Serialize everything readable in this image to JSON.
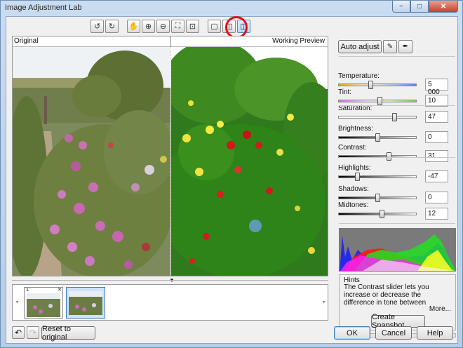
{
  "window": {
    "title": "Image Adjustment Lab",
    "minimize_glyph": "−",
    "maximize_glyph": "□",
    "close_glyph": "✕"
  },
  "toolbar": {
    "buttons": [
      {
        "name": "rotate-left-icon",
        "glyph": "↺"
      },
      {
        "name": "rotate-right-icon",
        "glyph": "↻"
      },
      {
        "name": "pan-hand-icon",
        "glyph": "✋"
      },
      {
        "name": "zoom-in-icon",
        "glyph": "⊕"
      },
      {
        "name": "zoom-out-icon",
        "glyph": "⊖"
      },
      {
        "name": "fit-to-window-icon",
        "glyph": "⛶"
      },
      {
        "name": "actual-size-icon",
        "glyph": "⊡"
      },
      {
        "name": "single-view-icon",
        "glyph": "▢"
      },
      {
        "name": "side-by-side-view-icon",
        "glyph": "◫"
      },
      {
        "name": "split-view-icon",
        "glyph": "◫"
      }
    ],
    "selected": "split-view-icon"
  },
  "preview": {
    "left_label": "Original",
    "right_label": "Working Preview",
    "collapse_glyph": "▼"
  },
  "filmstrip": {
    "left_arrow": "◂",
    "right_arrow": "▸",
    "thumbs": [
      {
        "number": "1",
        "close_glyph": "✕"
      },
      {
        "number": "",
        "close_glyph": ""
      }
    ]
  },
  "controls": {
    "auto_adjust": "Auto adjust",
    "sliders": [
      {
        "label": "Temperature:",
        "value": "5 000",
        "position": 0.41,
        "gradient": "linear-gradient(90deg,#f0a01e,#f6d690,#dcdcdc,#9ac0f0,#4c8ae8)"
      },
      {
        "label": "Tint:",
        "value": "10",
        "position": 0.53,
        "gradient": "linear-gradient(90deg,#d86cf0,#eecdf6,#d8f0c0,#7ed04a)"
      },
      {
        "label": "Saturation:",
        "value": "47",
        "position": 0.71,
        "gradient": "linear-gradient(90deg,#ffffff,#f2f2f2)"
      },
      {
        "label": "Brightness:",
        "value": "0",
        "position": 0.5,
        "gradient": "linear-gradient(90deg,#000000,#ffffff)"
      },
      {
        "label": "Contrast:",
        "value": "31",
        "position": 0.64,
        "gradient": "linear-gradient(90deg,#000000,#ffffff)"
      },
      {
        "label": "Highlights:",
        "value": "-47",
        "position": 0.24,
        "gradient": "linear-gradient(90deg,#000000,#ffffff)"
      },
      {
        "label": "Shadows:",
        "value": "0",
        "position": 0.5,
        "gradient": "linear-gradient(90deg,#000000,#ffffff)"
      },
      {
        "label": "Midtones:",
        "value": "12",
        "position": 0.55,
        "gradient": "linear-gradient(90deg,#000000,#ffffff)"
      }
    ]
  },
  "hints": {
    "title": "Hints",
    "text": "The Contrast slider lets you increase or decrease the difference in tone between",
    "more": "More..."
  },
  "buttons": {
    "create_snapshot": "Create Snapshot",
    "reset": "Reset to original",
    "ok": "OK",
    "cancel": "Cancel",
    "help": "Help"
  }
}
